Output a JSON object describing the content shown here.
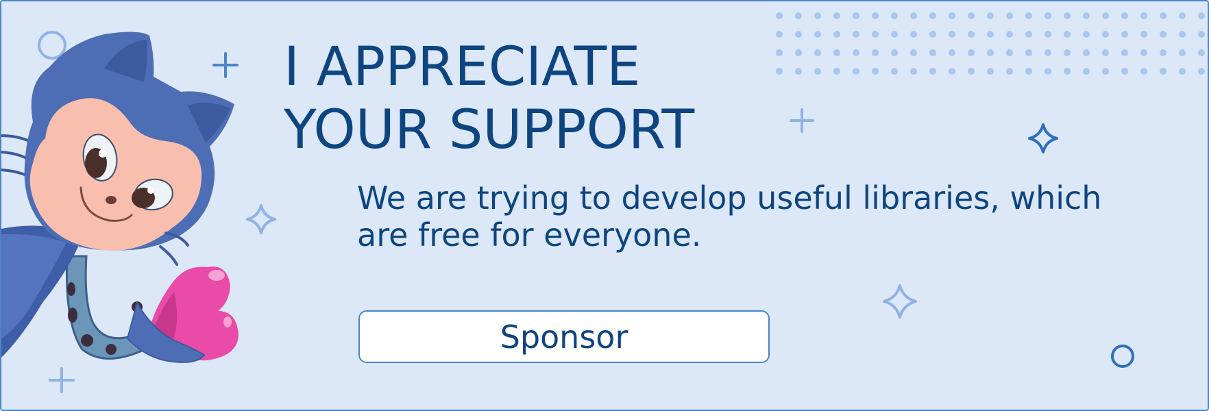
{
  "banner": {
    "heading_line1": "I APPRECIATE",
    "heading_line2": "YOUR SUPPORT",
    "message_line1": "We are trying to develop useful libraries, which",
    "message_line2": "are free for everyone.",
    "sponsor_label": "Sponsor"
  },
  "colors": {
    "background": "#dce7f7",
    "border": "#4a86c8",
    "text": "#0e4580",
    "accent_light": "#8fb3e3",
    "accent_dark": "#2f6fc2",
    "mascot_body": "#4d6db5",
    "heart": "#ea4aa8"
  },
  "icons": {
    "mascot": "octocat-mascot-holding-heart",
    "sparkles": "four-point-star-icon",
    "plus": "plus-icon",
    "ring": "circle-outline-icon"
  }
}
